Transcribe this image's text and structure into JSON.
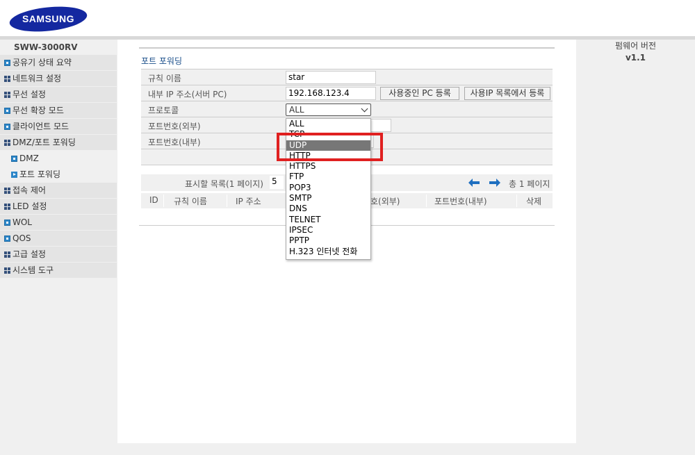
{
  "brand": {
    "logo_text": "SAMSUNG",
    "logo_color": "#1428a0"
  },
  "sidebar": {
    "model": "SWW-3000RV",
    "items": [
      {
        "label": "공유기 상태 요약",
        "icon": "blue-square-icon"
      },
      {
        "label": "네트워크 설정",
        "icon": "grid-icon"
      },
      {
        "label": "무선 설정",
        "icon": "grid-icon"
      },
      {
        "label": "무선 확장 모드",
        "icon": "blue-square-icon"
      },
      {
        "label": "클라이언트 모드",
        "icon": "blue-square-icon"
      },
      {
        "label": "DMZ/포트 포워딩",
        "icon": "grid-icon"
      },
      {
        "label": "DMZ",
        "icon": "blue-square-icon"
      },
      {
        "label": "포트 포워딩",
        "icon": "arrow-icon"
      },
      {
        "label": "접속 제어",
        "icon": "grid-icon"
      },
      {
        "label": "LED 설정",
        "icon": "grid-icon"
      },
      {
        "label": "WOL",
        "icon": "blue-square-icon"
      },
      {
        "label": "QOS",
        "icon": "blue-square-icon"
      },
      {
        "label": "고급 설정",
        "icon": "grid-icon"
      },
      {
        "label": "시스템 도구",
        "icon": "grid-icon"
      }
    ]
  },
  "main": {
    "title": "포트 포워딩",
    "form": {
      "rule_name_label": "규칙 이름",
      "rule_name_value": "star",
      "internal_ip_label": "내부 IP 주소(서버 PC)",
      "internal_ip_value": "192.168.123.4",
      "register_pc_button": "사용중인 PC 등록",
      "register_ip_list_button": "사용IP 목록에서 등록",
      "protocol_label": "프로토콜",
      "protocol_value": "ALL",
      "external_port_label": "포트번호(외부)",
      "internal_port_label": "포트번호(내부)"
    },
    "list": {
      "display_label": "표시할 목록(1 페이지)",
      "display_value": "5",
      "total_pages": "총 1 페이지",
      "columns": [
        "ID",
        "규칙 이름",
        "IP 주소",
        "호(외부)",
        "포트번호(내부)",
        "삭제"
      ]
    }
  },
  "dropdown": {
    "options": [
      "ALL",
      "TCP",
      "UDP",
      "HTTP",
      "HTTPS",
      "FTP",
      "POP3",
      "SMTP",
      "DNS",
      "TELNET",
      "IPSEC",
      "PPTP",
      "H.323 인터넷 전화"
    ],
    "highlighted": "UDP"
  },
  "firmware": {
    "label": "펌웨어 버전",
    "version": "v1.1"
  },
  "colors": {
    "accent": "#1a4e8a",
    "highlight_box": "#e02020",
    "selected_option": "#777777"
  }
}
